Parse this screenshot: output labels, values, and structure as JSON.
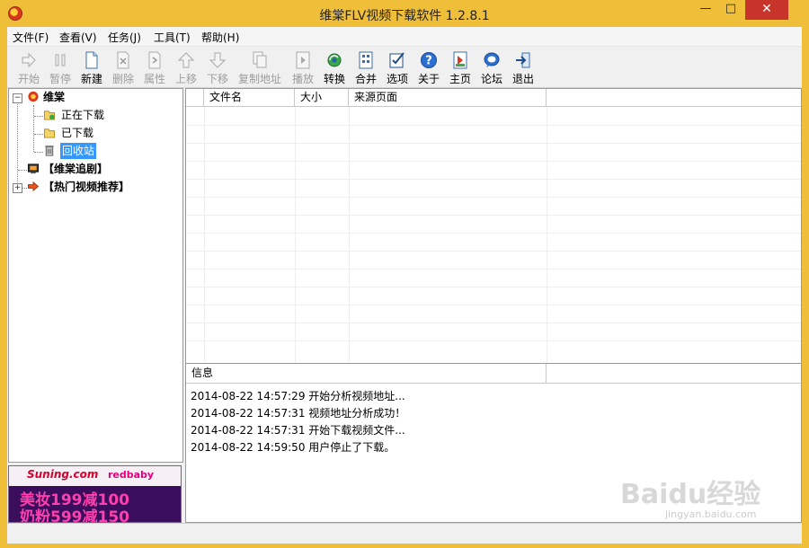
{
  "window": {
    "title": "维棠FLV视频下载软件 1.2.8.1",
    "min_glyph": "—",
    "max_glyph": "□",
    "close_glyph": "✕",
    "accent_color": "#f0bf3a",
    "close_color": "#c7352a"
  },
  "menu": [
    "文件(F)",
    "查看(V)",
    "任务(J)",
    "工具(T)",
    "帮助(H)"
  ],
  "toolbar": [
    {
      "label": "开始",
      "icon": "play-arrow-icon",
      "enabled": false
    },
    {
      "label": "暂停",
      "icon": "pause-icon",
      "enabled": false
    },
    {
      "label": "新建",
      "icon": "new-document-icon",
      "enabled": true
    },
    {
      "label": "删除",
      "icon": "delete-icon",
      "enabled": false
    },
    {
      "label": "属性",
      "icon": "properties-icon",
      "enabled": false
    },
    {
      "label": "上移",
      "icon": "move-up-icon",
      "enabled": false
    },
    {
      "label": "下移",
      "icon": "move-down-icon",
      "enabled": false
    },
    {
      "label": "复制地址",
      "icon": "copy-address-icon",
      "enabled": false
    },
    {
      "label": "播放",
      "icon": "play-video-icon",
      "enabled": false
    },
    {
      "label": "转换",
      "icon": "convert-icon",
      "enabled": true
    },
    {
      "label": "合并",
      "icon": "merge-icon",
      "enabled": true
    },
    {
      "label": "选项",
      "icon": "options-icon",
      "enabled": true
    },
    {
      "label": "关于",
      "icon": "about-icon",
      "enabled": true
    },
    {
      "label": "主页",
      "icon": "homepage-icon",
      "enabled": true
    },
    {
      "label": "论坛",
      "icon": "forum-icon",
      "enabled": true
    },
    {
      "label": "退出",
      "icon": "exit-icon",
      "enabled": true
    }
  ],
  "tree": {
    "root": {
      "label": "维棠",
      "expanded": true,
      "icon": "weitang-logo-icon"
    },
    "children": [
      {
        "label": "正在下载",
        "icon": "downloading-folder-icon"
      },
      {
        "label": "已下载",
        "icon": "downloaded-folder-icon"
      },
      {
        "label": "回收站",
        "icon": "recycle-bin-icon",
        "selected": true
      }
    ],
    "drama": {
      "label": "【维棠追剧】",
      "icon": "tv-icon"
    },
    "hot": {
      "label": "【热门视频推荐】",
      "icon": "arrow-right-icon",
      "expanded": false
    }
  },
  "ad": {
    "brand": "Suning.com",
    "partner": "redbaby",
    "line1": "美妆199减100",
    "line2": "奶粉599减150"
  },
  "list": {
    "columns": [
      "文件名",
      "大小",
      "来源页面"
    ],
    "rows": []
  },
  "info": {
    "header": "信息",
    "log": [
      "2014-08-22 14:57:29 开始分析视频地址...",
      "2014-08-22 14:57:31 视频地址分析成功！",
      "2014-08-22 14:57:31 开始下载视频文件...",
      "2014-08-22 14:59:50 用户停止了下载。"
    ]
  },
  "watermark": {
    "text": "Baidu经验",
    "sub": "jingyan.baidu.com"
  }
}
